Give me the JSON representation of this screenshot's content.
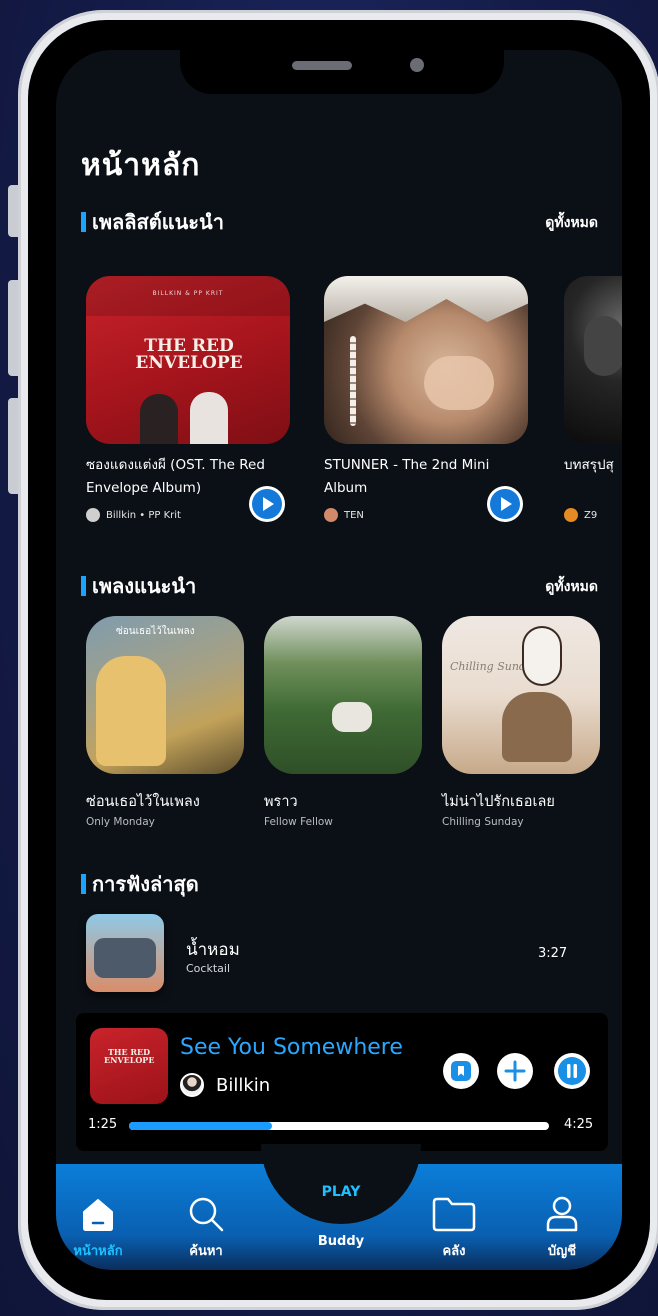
{
  "header": {
    "title": "หน้าหลัก"
  },
  "sections": {
    "playlists": {
      "title": "เพลลิสต์แนะนำ",
      "see_all": "ดูทั้งหมด",
      "items": [
        {
          "title": "ซองแดงแต่งผี (OST. The Red Envelope Album)",
          "artist": "Billkin • PP Krit",
          "cover_text_top": "BILLKIN & PP KRIT",
          "cover_text_main": "THE RED ENVELOPE"
        },
        {
          "title": "STUNNER - The 2nd Mini Album",
          "artist": "TEN"
        },
        {
          "title": "บทสรุปสุ",
          "artist": "Z9"
        }
      ]
    },
    "songs": {
      "title": "เพลงแนะนำ",
      "see_all": "ดูทั้งหมด",
      "items": [
        {
          "title": "ซ่อนเธอไว้ในเพลง",
          "artist": "Only Monday",
          "cover_text": "ซ่อนเธอไว้ในเพลง"
        },
        {
          "title": "พราว",
          "artist": "Fellow Fellow"
        },
        {
          "title": "ไม่น่าไปรักเธอเลย",
          "artist": "Chilling Sunday",
          "cover_text": "Chilling Sunday"
        }
      ]
    },
    "recent": {
      "title": "การฟังล่าสุด",
      "items": [
        {
          "title": "น้ำหอม",
          "artist": "Cocktail",
          "duration": "3:27"
        }
      ]
    }
  },
  "player": {
    "title": "See You Somewhere",
    "artist": "Billkin",
    "elapsed": "1:25",
    "total": "4:25",
    "progress_fraction": 0.34
  },
  "nav": {
    "items": [
      {
        "label": "หน้าหลัก",
        "icon": "home-icon",
        "active": true
      },
      {
        "label": "ค้นหา",
        "icon": "search-icon"
      },
      {
        "label": "Buddy",
        "top_label": "PLAY"
      },
      {
        "label": "คลัง",
        "icon": "folder-icon"
      },
      {
        "label": "บัญชี",
        "icon": "user-icon"
      }
    ]
  },
  "colors": {
    "accent": "#1aa3ff",
    "background": "#0b1016",
    "nav_gradient_top": "#0b7ed9"
  }
}
